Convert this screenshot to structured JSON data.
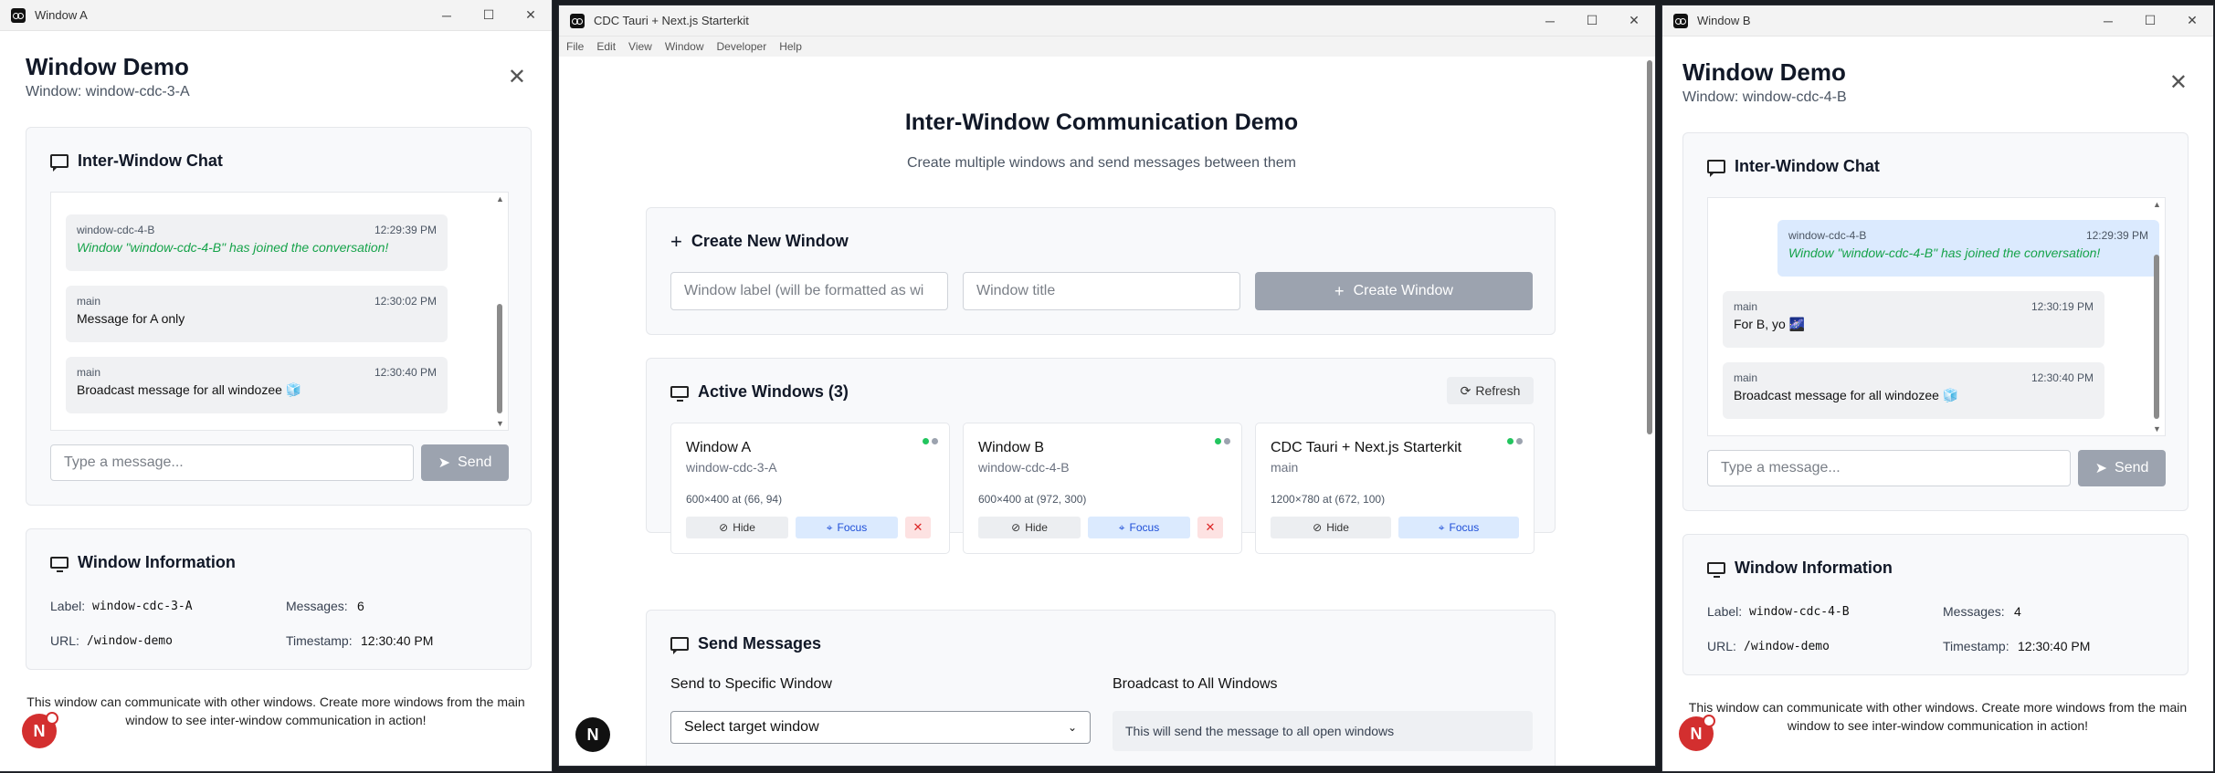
{
  "windowA": {
    "titlebar": "Window A",
    "title": "Window Demo",
    "subtitle": "Window: window-cdc-3-A",
    "chat_title": "Inter-Window Chat",
    "messages": [
      {
        "from": "window-cdc-4-B",
        "time": "12:29:39 PM",
        "text": "Window \"window-cdc-4-B\" has joined the conversation!"
      },
      {
        "from": "main",
        "time": "12:30:02 PM",
        "text": "Message for A only"
      },
      {
        "from": "main",
        "time": "12:30:40 PM",
        "text": "Broadcast message for all windozee 🧊"
      }
    ],
    "input_placeholder": "Type a message...",
    "send_label": "Send",
    "info_title": "Window Information",
    "info": {
      "label_k": "Label:",
      "label_v": "window-cdc-3-A",
      "messages_k": "Messages:",
      "messages_v": "6",
      "url_k": "URL:",
      "url_v": "/window-demo",
      "timestamp_k": "Timestamp:",
      "timestamp_v": "12:30:40 PM"
    },
    "footer": "This window can communicate with other windows. Create more windows from the main window to see inter-window communication in action!"
  },
  "main": {
    "titlebar": "CDC Tauri + Next.js Starterkit",
    "menu": [
      "File",
      "Edit",
      "View",
      "Window",
      "Developer",
      "Help"
    ],
    "title": "Inter-Window Communication Demo",
    "subtitle": "Create multiple windows and send messages between them",
    "create": {
      "heading": "Create New Window",
      "label_placeholder": "Window label (will be formatted as wi",
      "title_placeholder": "Window title",
      "button": "Create Window"
    },
    "active": {
      "heading": "Active Windows (3)",
      "refresh": "Refresh",
      "windows": [
        {
          "name": "Window A",
          "label": "window-cdc-3-A",
          "dims": "600×400 at (66, 94)",
          "hide": "Hide",
          "focus": "Focus",
          "close": "✕"
        },
        {
          "name": "Window B",
          "label": "window-cdc-4-B",
          "dims": "600×400 at (972, 300)",
          "hide": "Hide",
          "focus": "Focus",
          "close": "✕"
        },
        {
          "name": "CDC Tauri + Next.js Starterkit",
          "label": "main",
          "dims": "1200×780 at (672, 100)",
          "hide": "Hide",
          "focus": "Focus"
        }
      ]
    },
    "send": {
      "heading": "Send Messages",
      "specific_label": "Send to Specific Window",
      "select_value": "Select target window",
      "broadcast_label": "Broadcast to All Windows",
      "broadcast_info": "This will send the message to all open windows"
    }
  },
  "windowB": {
    "titlebar": "Window B",
    "title": "Window Demo",
    "subtitle": "Window: window-cdc-4-B",
    "chat_title": "Inter-Window Chat",
    "messages": [
      {
        "from": "window-cdc-4-B",
        "time": "12:29:39 PM",
        "text": "Window \"window-cdc-4-B\" has joined the conversation!"
      },
      {
        "from": "main",
        "time": "12:30:19 PM",
        "text": "For B, yo 🌌"
      },
      {
        "from": "main",
        "time": "12:30:40 PM",
        "text": "Broadcast message for all windozee 🧊"
      }
    ],
    "input_placeholder": "Type a message...",
    "send_label": "Send",
    "info_title": "Window Information",
    "info": {
      "label_k": "Label:",
      "label_v": "window-cdc-4-B",
      "messages_k": "Messages:",
      "messages_v": "4",
      "url_k": "URL:",
      "url_v": "/window-demo",
      "timestamp_k": "Timestamp:",
      "timestamp_v": "12:30:40 PM"
    },
    "footer": "This window can communicate with other windows. Create more windows from the main window to see inter-window communication in action!"
  },
  "badges": {
    "next": "N"
  },
  "colors": {
    "accent_blue": "#1d4ed8",
    "status_green": "#22c55e",
    "status_gray": "#9ca3af",
    "system_green": "#16a34a",
    "danger": "#dc2626"
  }
}
